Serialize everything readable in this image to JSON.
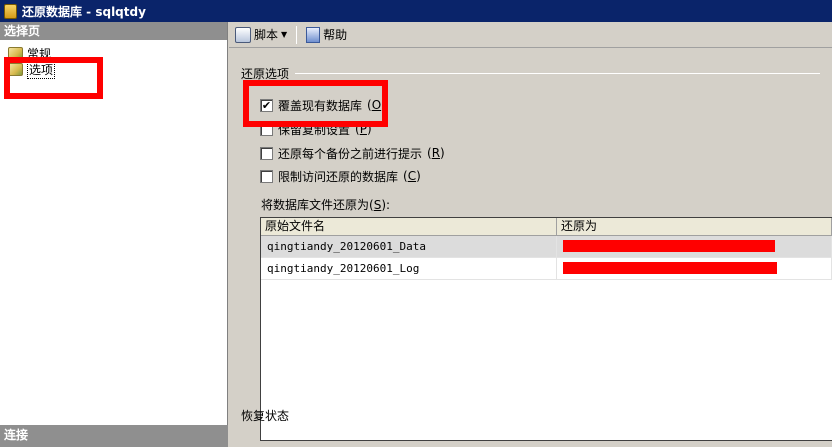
{
  "window": {
    "title": "还原数据库 - sqlqtdy"
  },
  "left_panel": {
    "header": "选择页",
    "items": [
      {
        "label": "常规"
      },
      {
        "label": "选项",
        "selected": true
      }
    ],
    "footer": "连接"
  },
  "toolbar": {
    "script_label": "脚本",
    "help_label": "帮助"
  },
  "restore_options": {
    "group_title": "还原选项",
    "options": [
      {
        "label": "覆盖现有数据库",
        "accel": "O",
        "checked": true
      },
      {
        "label": "保留复制设置",
        "accel": "P",
        "checked": false
      },
      {
        "label": "还原每个备份之前进行提示",
        "accel": "R",
        "checked": false
      },
      {
        "label": "限制访问还原的数据库",
        "accel": "C",
        "checked": false
      }
    ]
  },
  "file_grid": {
    "caption": "将数据库文件还原为",
    "caption_accel": "S",
    "columns": [
      "原始文件名",
      "还原为"
    ],
    "rows": [
      {
        "original": "qingtiandy_20120601_Data",
        "restore_to": ""
      },
      {
        "original": "qingtiandy_20120601_Log",
        "restore_to": ""
      }
    ]
  },
  "recovery_state": {
    "group_title": "恢复状态"
  },
  "colors": {
    "annotation": "#ff0000",
    "title_bar": "#0a246a",
    "panel_header": "#8f8f8f"
  }
}
